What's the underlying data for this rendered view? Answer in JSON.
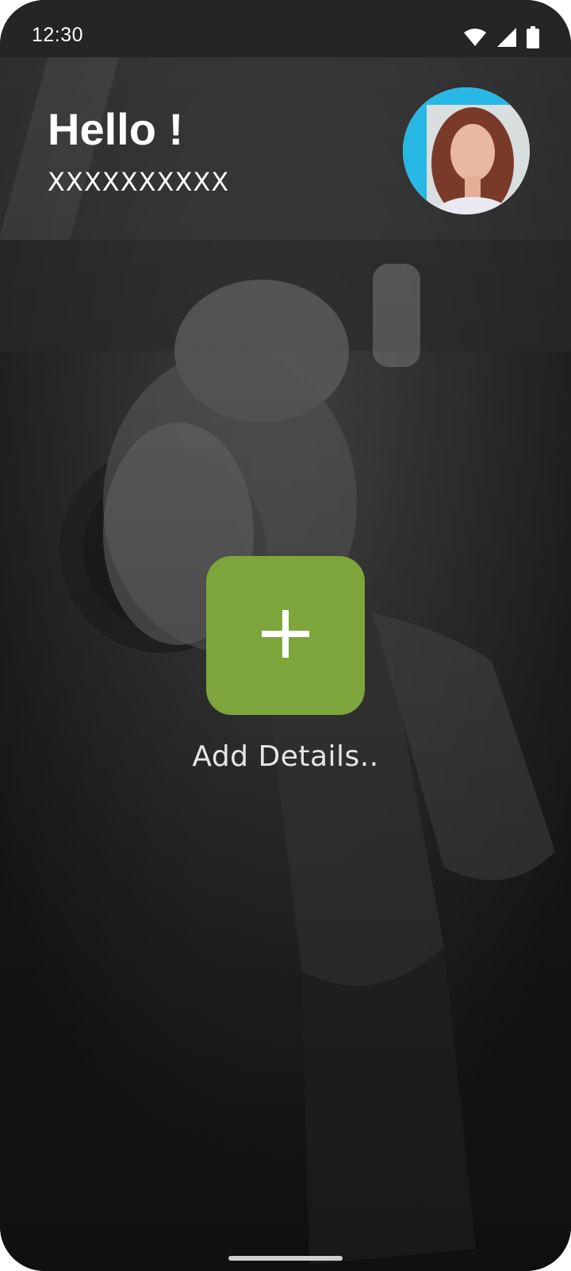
{
  "status_bar": {
    "time": "12:30",
    "icons": [
      "wifi-icon",
      "signal-icon",
      "battery-icon"
    ]
  },
  "header": {
    "greeting": "Hello !",
    "user_name": "XXXXXXXXXX"
  },
  "main": {
    "add_button_icon": "plus-icon",
    "add_label": "Add Details.."
  },
  "colors": {
    "accent": "#7ea53b",
    "background": "#1c1d1f",
    "status_bar": "#242527",
    "text": "#ffffff"
  }
}
